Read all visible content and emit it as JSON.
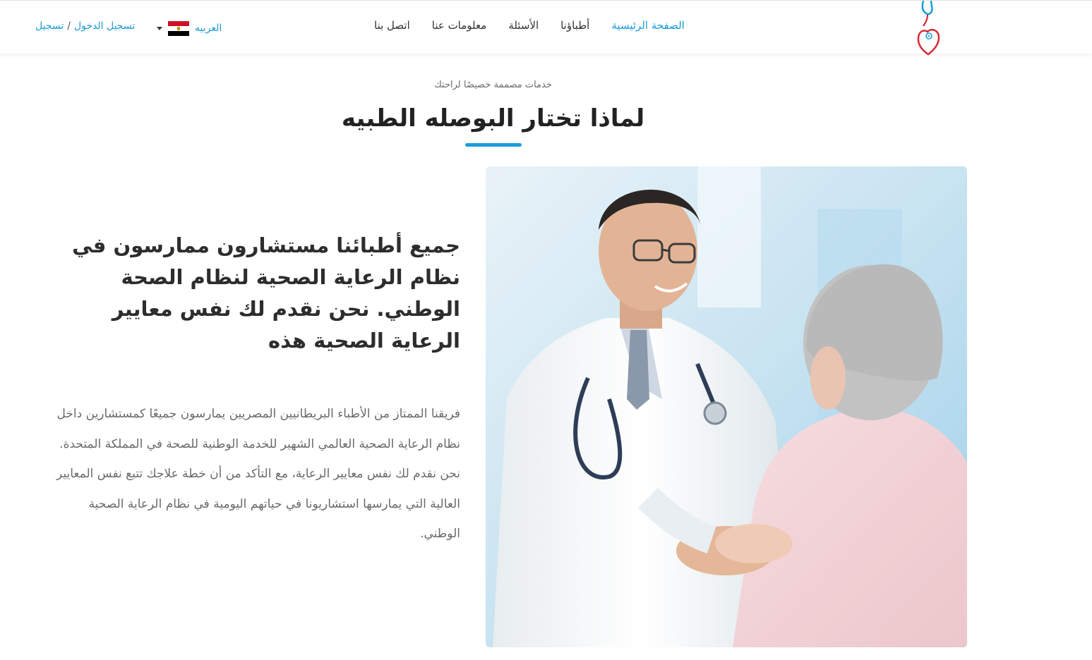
{
  "header": {
    "logo_icon": "stethoscope-heart-icon",
    "nav": [
      {
        "label": "الصفحة الرئيسية",
        "active": true
      },
      {
        "label": "أطباؤنا",
        "active": false
      },
      {
        "label": "الأسئلة",
        "active": false
      },
      {
        "label": "معلومات عنا",
        "active": false
      },
      {
        "label": "اتصل بنا",
        "active": false
      }
    ],
    "language": {
      "label": "العربيه",
      "flag_icon": "egypt-flag-icon"
    },
    "auth": {
      "login": "تسجيل الدخول",
      "separator": "/",
      "register": "تسجيل"
    }
  },
  "section": {
    "subtitle": "خدمات مصممة خصيصًا لراحتك",
    "title": "لماذا تختار البوصله الطبيه",
    "image_alt": "doctor-holding-elderly-patient-hands-photo",
    "heading": "جميع أطبائنا مستشارون ممارسون في نظام الرعاية الصحية لنظام الصحة الوطني. نحن نقدم لك نفس معايير الرعاية الصحية هذه",
    "body": "فريقنا الممتاز من الأطباء البريطانيين المصريين يمارسون جميعًا كمستشارين داخل نظام الرعاية الصحية العالمي الشهير للخدمة الوطنية للصحة في المملكة المتحدة. نحن نقدم لك نفس معايير الرعاية، مع التأكد من أن خطة علاجك تتبع نفس المعايير العالية التي يمارسها استشاريونا في حياتهم اليومية في نظام الرعاية الصحية الوطني."
  },
  "colors": {
    "accent": "#1a9bd7",
    "logo_red": "#d62a32",
    "heading_text": "#222222",
    "body_text": "#6a6a6a"
  }
}
